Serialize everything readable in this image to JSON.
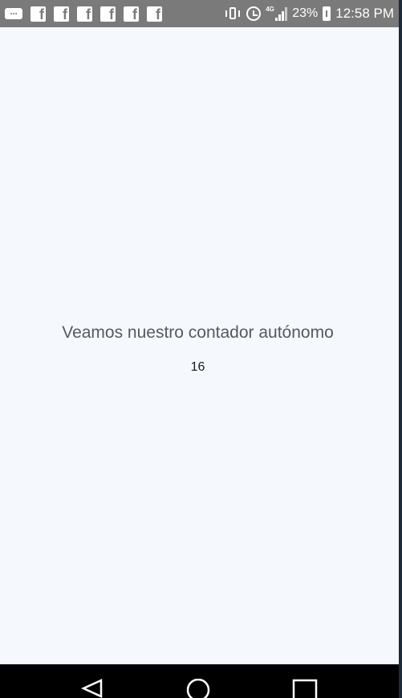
{
  "status_bar": {
    "notifications": [
      "message-icon",
      "facebook-icon",
      "facebook-icon",
      "facebook-icon",
      "facebook-icon",
      "facebook-icon",
      "facebook-icon"
    ],
    "battery_percent": "23%",
    "time": "12:58 PM",
    "network": "4G"
  },
  "main": {
    "title": "Veamos nuestro contador autónomo",
    "counter": "16"
  },
  "nav_bar": {
    "buttons": [
      "back",
      "home",
      "recents"
    ]
  },
  "colors": {
    "status_bar_bg": "#7a7a7a",
    "page_bg": "#f5f9fd",
    "nav_bar_bg": "#000000",
    "title_text": "#555a60"
  }
}
